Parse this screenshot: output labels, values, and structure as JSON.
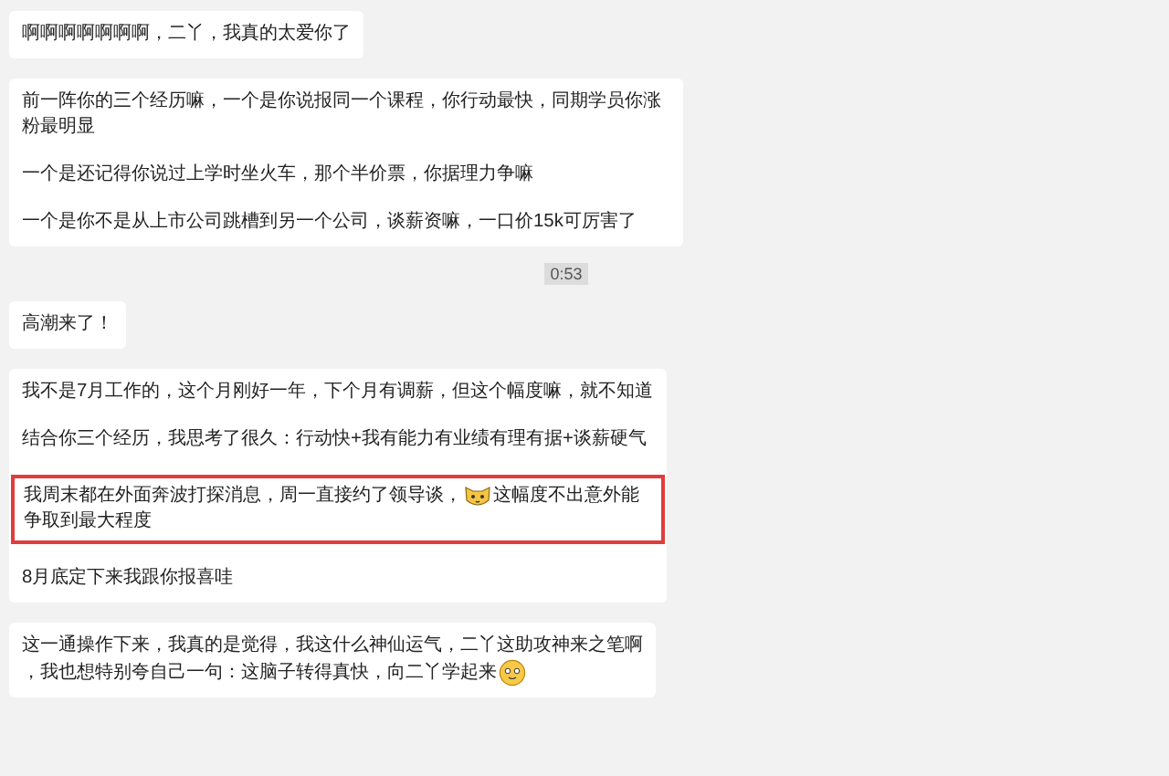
{
  "messages": [
    {
      "kind": "bubble",
      "paragraphs": [
        {
          "highlighted": false,
          "lines": [
            [
              {
                "kind": "text",
                "text": "啊啊啊啊啊啊啊，二丫，我真的太爱你了"
              }
            ]
          ]
        }
      ]
    },
    {
      "kind": "bubble",
      "paragraphs": [
        {
          "highlighted": false,
          "lines": [
            [
              {
                "kind": "text",
                "text": "前一阵你的三个经历嘛，一个是你说报同一个课程，你行动最快，同期学员你涨粉最明显"
              }
            ]
          ]
        },
        {
          "highlighted": false,
          "lines": [
            [
              {
                "kind": "text",
                "text": "一个是还记得你说过上学时坐火车，那个半价票，你据理力争嘛"
              }
            ]
          ]
        },
        {
          "highlighted": false,
          "lines": [
            [
              {
                "kind": "text",
                "text": "一个是你不是从上市公司跳槽到另一个公司，谈薪资嘛，一口价15k可厉害了"
              }
            ]
          ]
        }
      ]
    },
    {
      "kind": "time",
      "text": "0:53"
    },
    {
      "kind": "bubble",
      "paragraphs": [
        {
          "highlighted": false,
          "lines": [
            [
              {
                "kind": "text",
                "text": "高潮来了！"
              }
            ]
          ]
        }
      ]
    },
    {
      "kind": "bubble",
      "paragraphs": [
        {
          "highlighted": false,
          "lines": [
            [
              {
                "kind": "text",
                "text": "我不是7月工作的，这个月刚好一年，下个月有调薪，但这个幅度嘛，就不知道"
              }
            ]
          ]
        },
        {
          "highlighted": false,
          "lines": [
            [
              {
                "kind": "text",
                "text": "结合你三个经历，我思考了很久：行动快+我有能力有业绩有理有据+谈薪硬气"
              }
            ]
          ]
        },
        {
          "highlighted": true,
          "lines": [
            [
              {
                "kind": "text",
                "text": "我周末都在外面奔波打探消息，周一直接约了领导谈，"
              },
              {
                "kind": "cat"
              },
              {
                "kind": "text",
                "text": "这幅度不出意外能"
              }
            ],
            [
              {
                "kind": "text",
                "text": "争取到最大程度"
              }
            ]
          ]
        },
        {
          "highlighted": false,
          "lines": [
            [
              {
                "kind": "text",
                "text": "8月底定下来我跟你报喜哇"
              }
            ]
          ]
        }
      ]
    },
    {
      "kind": "bubble",
      "paragraphs": [
        {
          "highlighted": false,
          "lines": [
            [
              {
                "kind": "text",
                "text": "这一通操作下来，我真的是觉得，我这什么神仙运气，二丫这助攻神来之笔啊"
              }
            ],
            [
              {
                "kind": "text",
                "text": "，我也想特别夸自己一句：这脑子转得真快，向二丫学起来"
              },
              {
                "kind": "face"
              }
            ]
          ]
        }
      ]
    }
  ]
}
